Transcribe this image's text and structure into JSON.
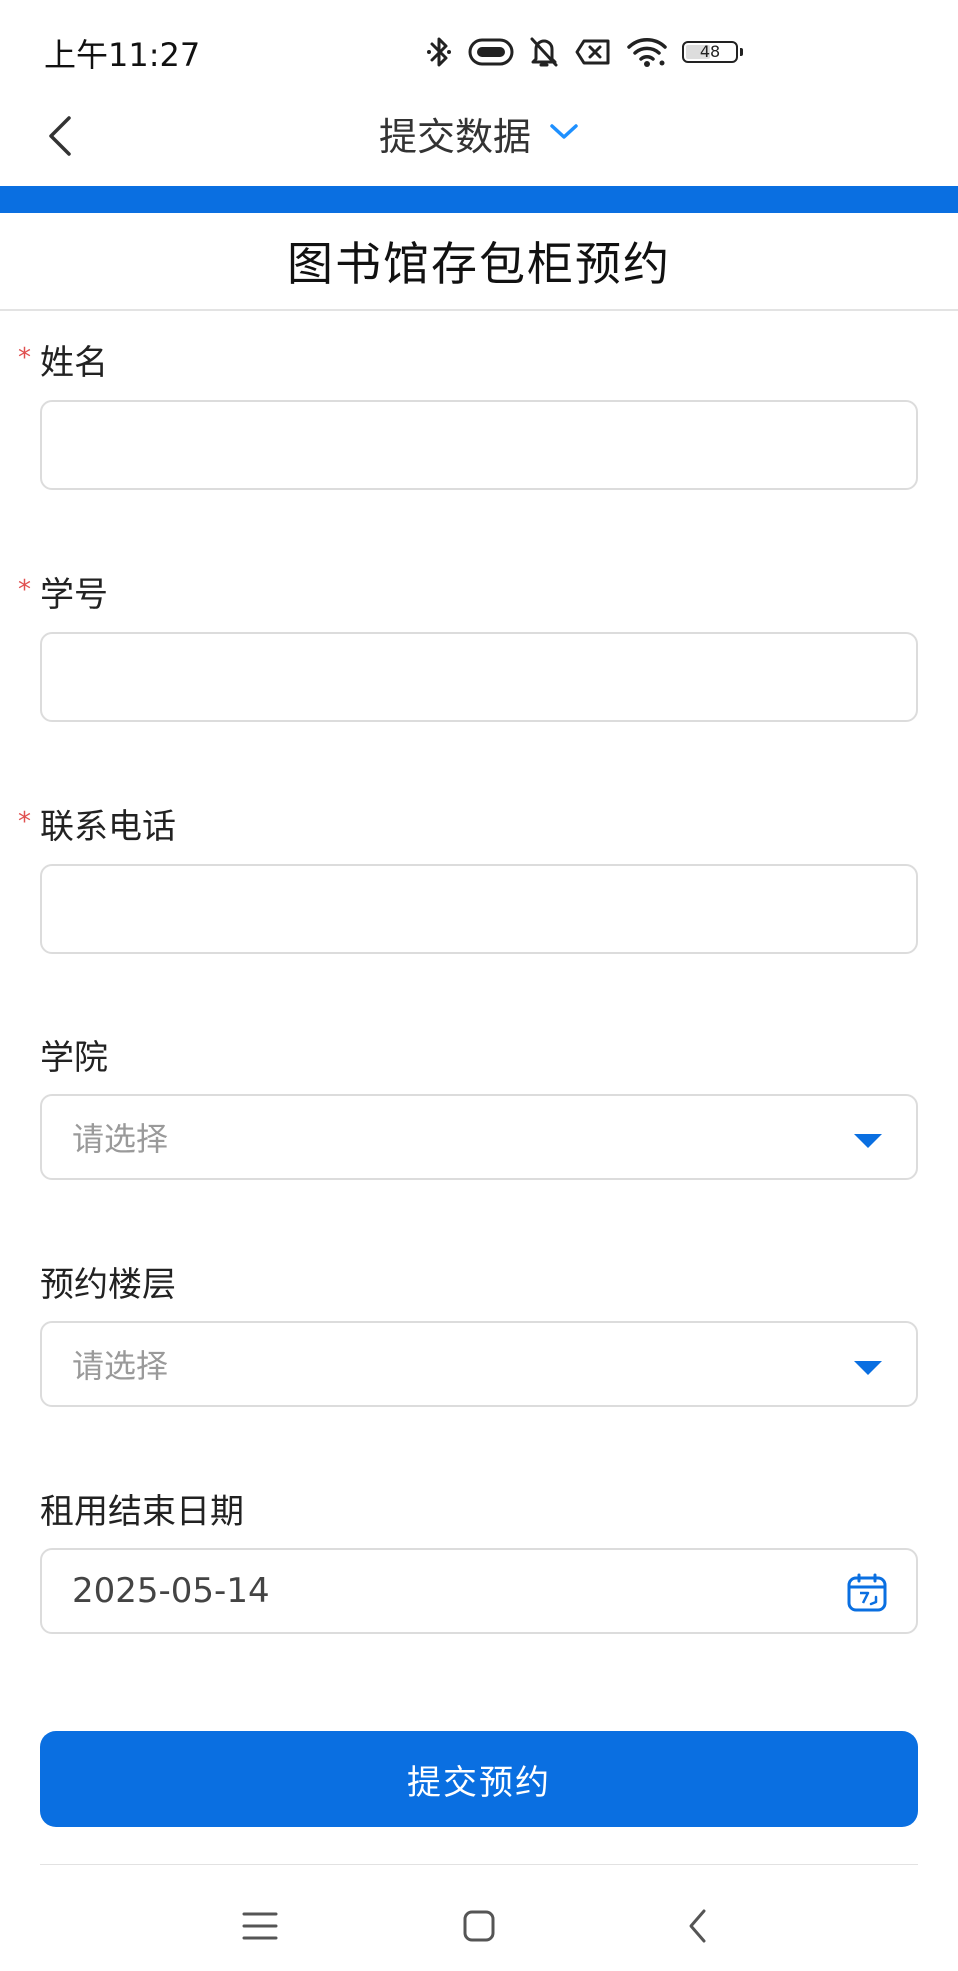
{
  "status_bar": {
    "time": "上午11:27",
    "battery": "48",
    "icons": [
      "bluetooth-icon",
      "nfc-icon",
      "bell-off-icon",
      "no-sim-icon",
      "wifi-icon",
      "battery-icon"
    ]
  },
  "nav": {
    "title": "提交数据",
    "back_icon": "chevron-left-icon",
    "dropdown_icon": "chevron-down-icon"
  },
  "form": {
    "title": "图书馆存包柜预约",
    "fields": [
      {
        "label": "姓名",
        "required": true,
        "type": "text",
        "value": ""
      },
      {
        "label": "学号",
        "required": true,
        "type": "text",
        "value": ""
      },
      {
        "label": "联系电话",
        "required": true,
        "type": "text",
        "value": ""
      },
      {
        "label": "学院",
        "required": false,
        "type": "select",
        "placeholder": "请选择"
      },
      {
        "label": "预约楼层",
        "required": false,
        "type": "select",
        "placeholder": "请选择"
      },
      {
        "label": "租用结束日期",
        "required": false,
        "type": "date",
        "value": "2025-05-14"
      }
    ],
    "required_mark": "*",
    "submit_label": "提交预约"
  },
  "system_nav": {
    "menu_icon": "menu-icon",
    "home_icon": "home-icon",
    "back_icon": "back-icon"
  },
  "colors": {
    "accent": "#0a6fe1",
    "required": "#e05050",
    "border": "#dcdcdc",
    "placeholder": "#9a9a9a"
  }
}
